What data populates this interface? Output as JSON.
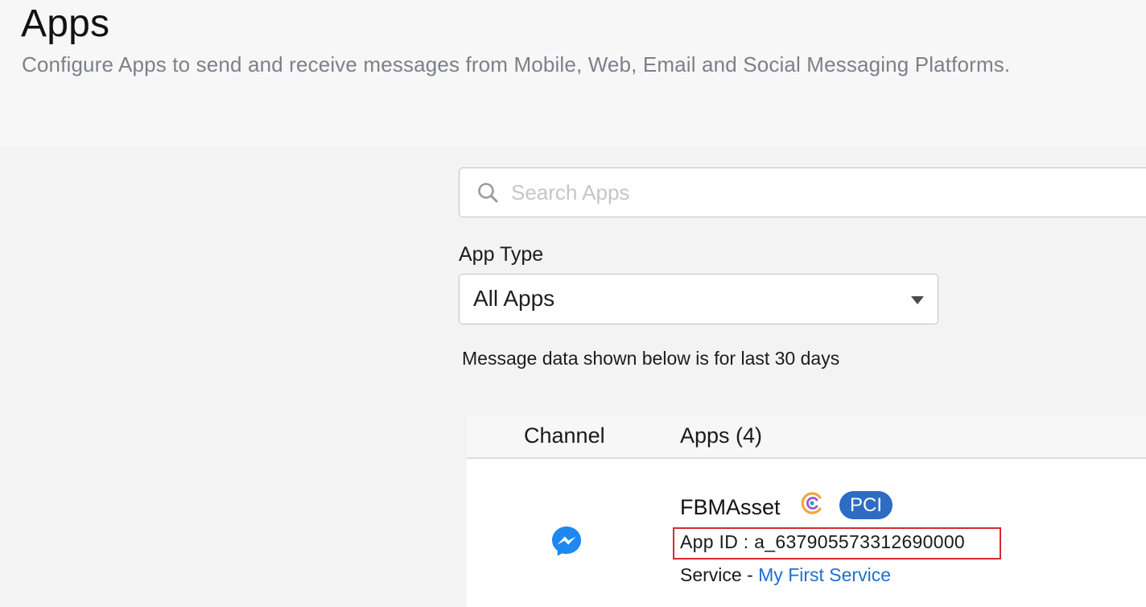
{
  "header": {
    "title": "Apps",
    "subtitle": "Configure Apps to send and receive messages from Mobile, Web, Email and Social Messaging Platforms."
  },
  "search": {
    "placeholder": "Search Apps",
    "value": ""
  },
  "filter": {
    "label": "App Type",
    "selected": "All Apps"
  },
  "note": "Message data shown below is for last 30 days",
  "table": {
    "columns": {
      "channel": "Channel",
      "apps": "Apps (4)"
    },
    "rows": [
      {
        "channel_icon": "messenger-icon",
        "name": "FBMAsset",
        "app_icon": "webex-icon",
        "badge": "PCI",
        "app_id": "App ID : a_637905573312690000",
        "service_prefix": "Service - ",
        "service_link": "My First Service"
      }
    ]
  },
  "colors": {
    "link": "#1f6fd1",
    "badge": "#2d6cc2",
    "highlight_border": "#d52b33",
    "messenger": "#1e88f0"
  }
}
